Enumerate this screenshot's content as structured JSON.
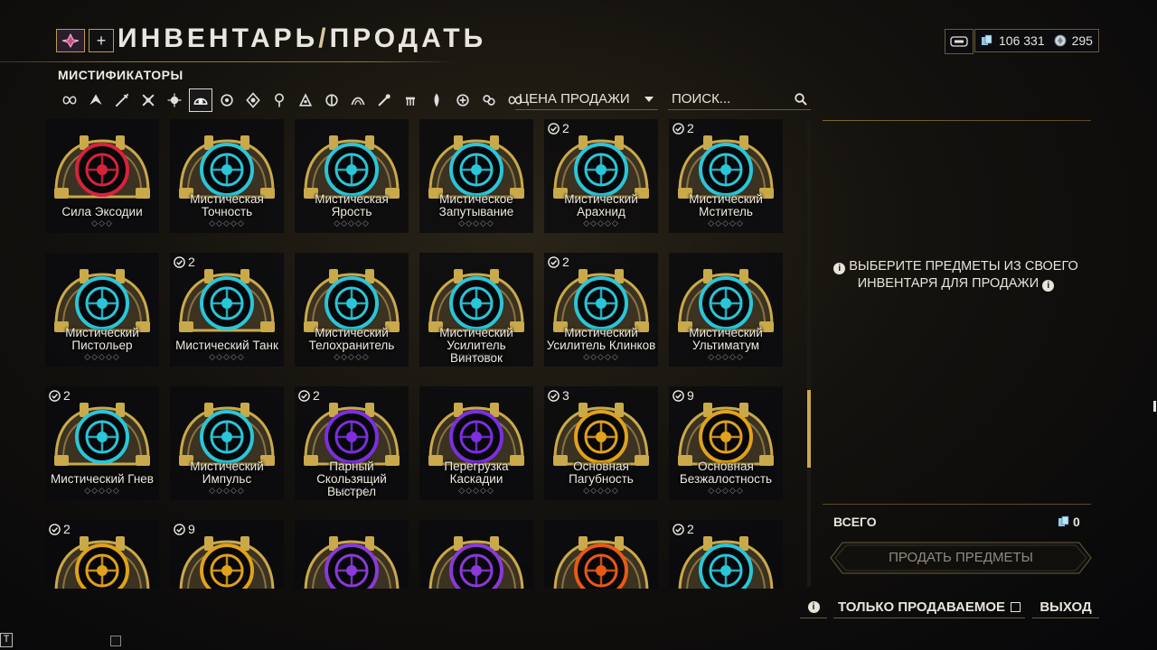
{
  "header": {
    "title_a": "ИНВЕНТАРЬ",
    "title_sep": "/",
    "title_b": "ПРОДАТЬ",
    "credits": "106 331",
    "platinum": "295",
    "category": "МИСТИФИКАТОРЫ"
  },
  "filters": {
    "icons": [
      "infinity-icon",
      "warframe-icon",
      "primary-weapon-icon",
      "secondary-weapon-icon",
      "melee-icon",
      "mods-icon",
      "companion-icon",
      "sentinel-icon",
      "archwing-icon",
      "gear-icon",
      "resources-icon",
      "relic-icon",
      "arcane-icon",
      "fish-icon",
      "plant-icon",
      "key-icon",
      "misc-icon",
      "emblem-icon"
    ],
    "active_index": 5
  },
  "sort": {
    "label": "ЦЕНА ПРОДАЖИ"
  },
  "search": {
    "placeholder": "ПОИСК..."
  },
  "items": [
    {
      "name": "Сила Эксодии",
      "count": "",
      "color": "#d8223c",
      "ranks": 3
    },
    {
      "name": "Мистическая Точность",
      "count": "",
      "color": "#29c6d8",
      "ranks": 5
    },
    {
      "name": "Мистическая Ярость",
      "count": "",
      "color": "#29c6d8",
      "ranks": 5
    },
    {
      "name": "Мистическое Запутывание",
      "count": "",
      "color": "#29c6d8",
      "ranks": 5
    },
    {
      "name": "Мистический Арахнид",
      "count": "2",
      "color": "#29c6d8",
      "ranks": 5
    },
    {
      "name": "Мистический Мститель",
      "count": "2",
      "color": "#29c6d8",
      "ranks": 5
    },
    {
      "name": "Мистический Пистольер",
      "count": "",
      "color": "#29c6d8",
      "ranks": 5
    },
    {
      "name": "Мистический Танк",
      "count": "2",
      "color": "#29c6d8",
      "ranks": 5
    },
    {
      "name": "Мистический Телохранитель",
      "count": "",
      "color": "#29c6d8",
      "ranks": 5
    },
    {
      "name": "Мистический Усилитель Винтовок",
      "count": "",
      "color": "#29c6d8",
      "ranks": 5
    },
    {
      "name": "Мистический Усилитель Клинков",
      "count": "2",
      "color": "#29c6d8",
      "ranks": 5
    },
    {
      "name": "Мистический Ультиматум",
      "count": "",
      "color": "#29c6d8",
      "ranks": 5
    },
    {
      "name": "Мистический Гнев",
      "count": "2",
      "color": "#29c6d8",
      "ranks": 5
    },
    {
      "name": "Мистический Импульс",
      "count": "",
      "color": "#29c6d8",
      "ranks": 5
    },
    {
      "name": "Парный Скользящий Выстрел",
      "count": "2",
      "color": "#7b2fe0",
      "ranks": 5
    },
    {
      "name": "Перегрузка Каскадии",
      "count": "",
      "color": "#7b2fe0",
      "ranks": 5
    },
    {
      "name": "Основная Пагубность",
      "count": "3",
      "color": "#e0a21c",
      "ranks": 5
    },
    {
      "name": "Основная Безжалостность",
      "count": "9",
      "color": "#e0a21c",
      "ranks": 5
    },
    {
      "name": "",
      "count": "2",
      "color": "#e0a21c",
      "ranks": 0
    },
    {
      "name": "",
      "count": "9",
      "color": "#e0a21c",
      "ranks": 0
    },
    {
      "name": "",
      "count": "",
      "color": "#8a3ad8",
      "ranks": 0
    },
    {
      "name": "",
      "count": "",
      "color": "#8a3ad8",
      "ranks": 0
    },
    {
      "name": "",
      "count": "",
      "color": "#e85a14",
      "ranks": 0
    },
    {
      "name": "",
      "count": "2",
      "color": "#29c6d8",
      "ranks": 0
    }
  ],
  "right_panel": {
    "message_line1": "ВЫБЕРИТЕ ПРЕДМЕТЫ ИЗ СВОЕГО",
    "message_line2": "ИНВЕНТАРЯ ДЛЯ ПРОДАЖИ",
    "total_label": "ВСЕГО",
    "total_value": "0",
    "sell_button": "ПРОДАТЬ ПРЕДМЕТЫ"
  },
  "footer": {
    "sell_only": "ТОЛЬКО ПРОДАВАЕМОЕ",
    "exit": "ВЫХОД",
    "t_key": "T"
  },
  "colors": {
    "gold": "#c9a94a",
    "panel_bg": "#0a0a0e",
    "text": "#e8e4da"
  }
}
